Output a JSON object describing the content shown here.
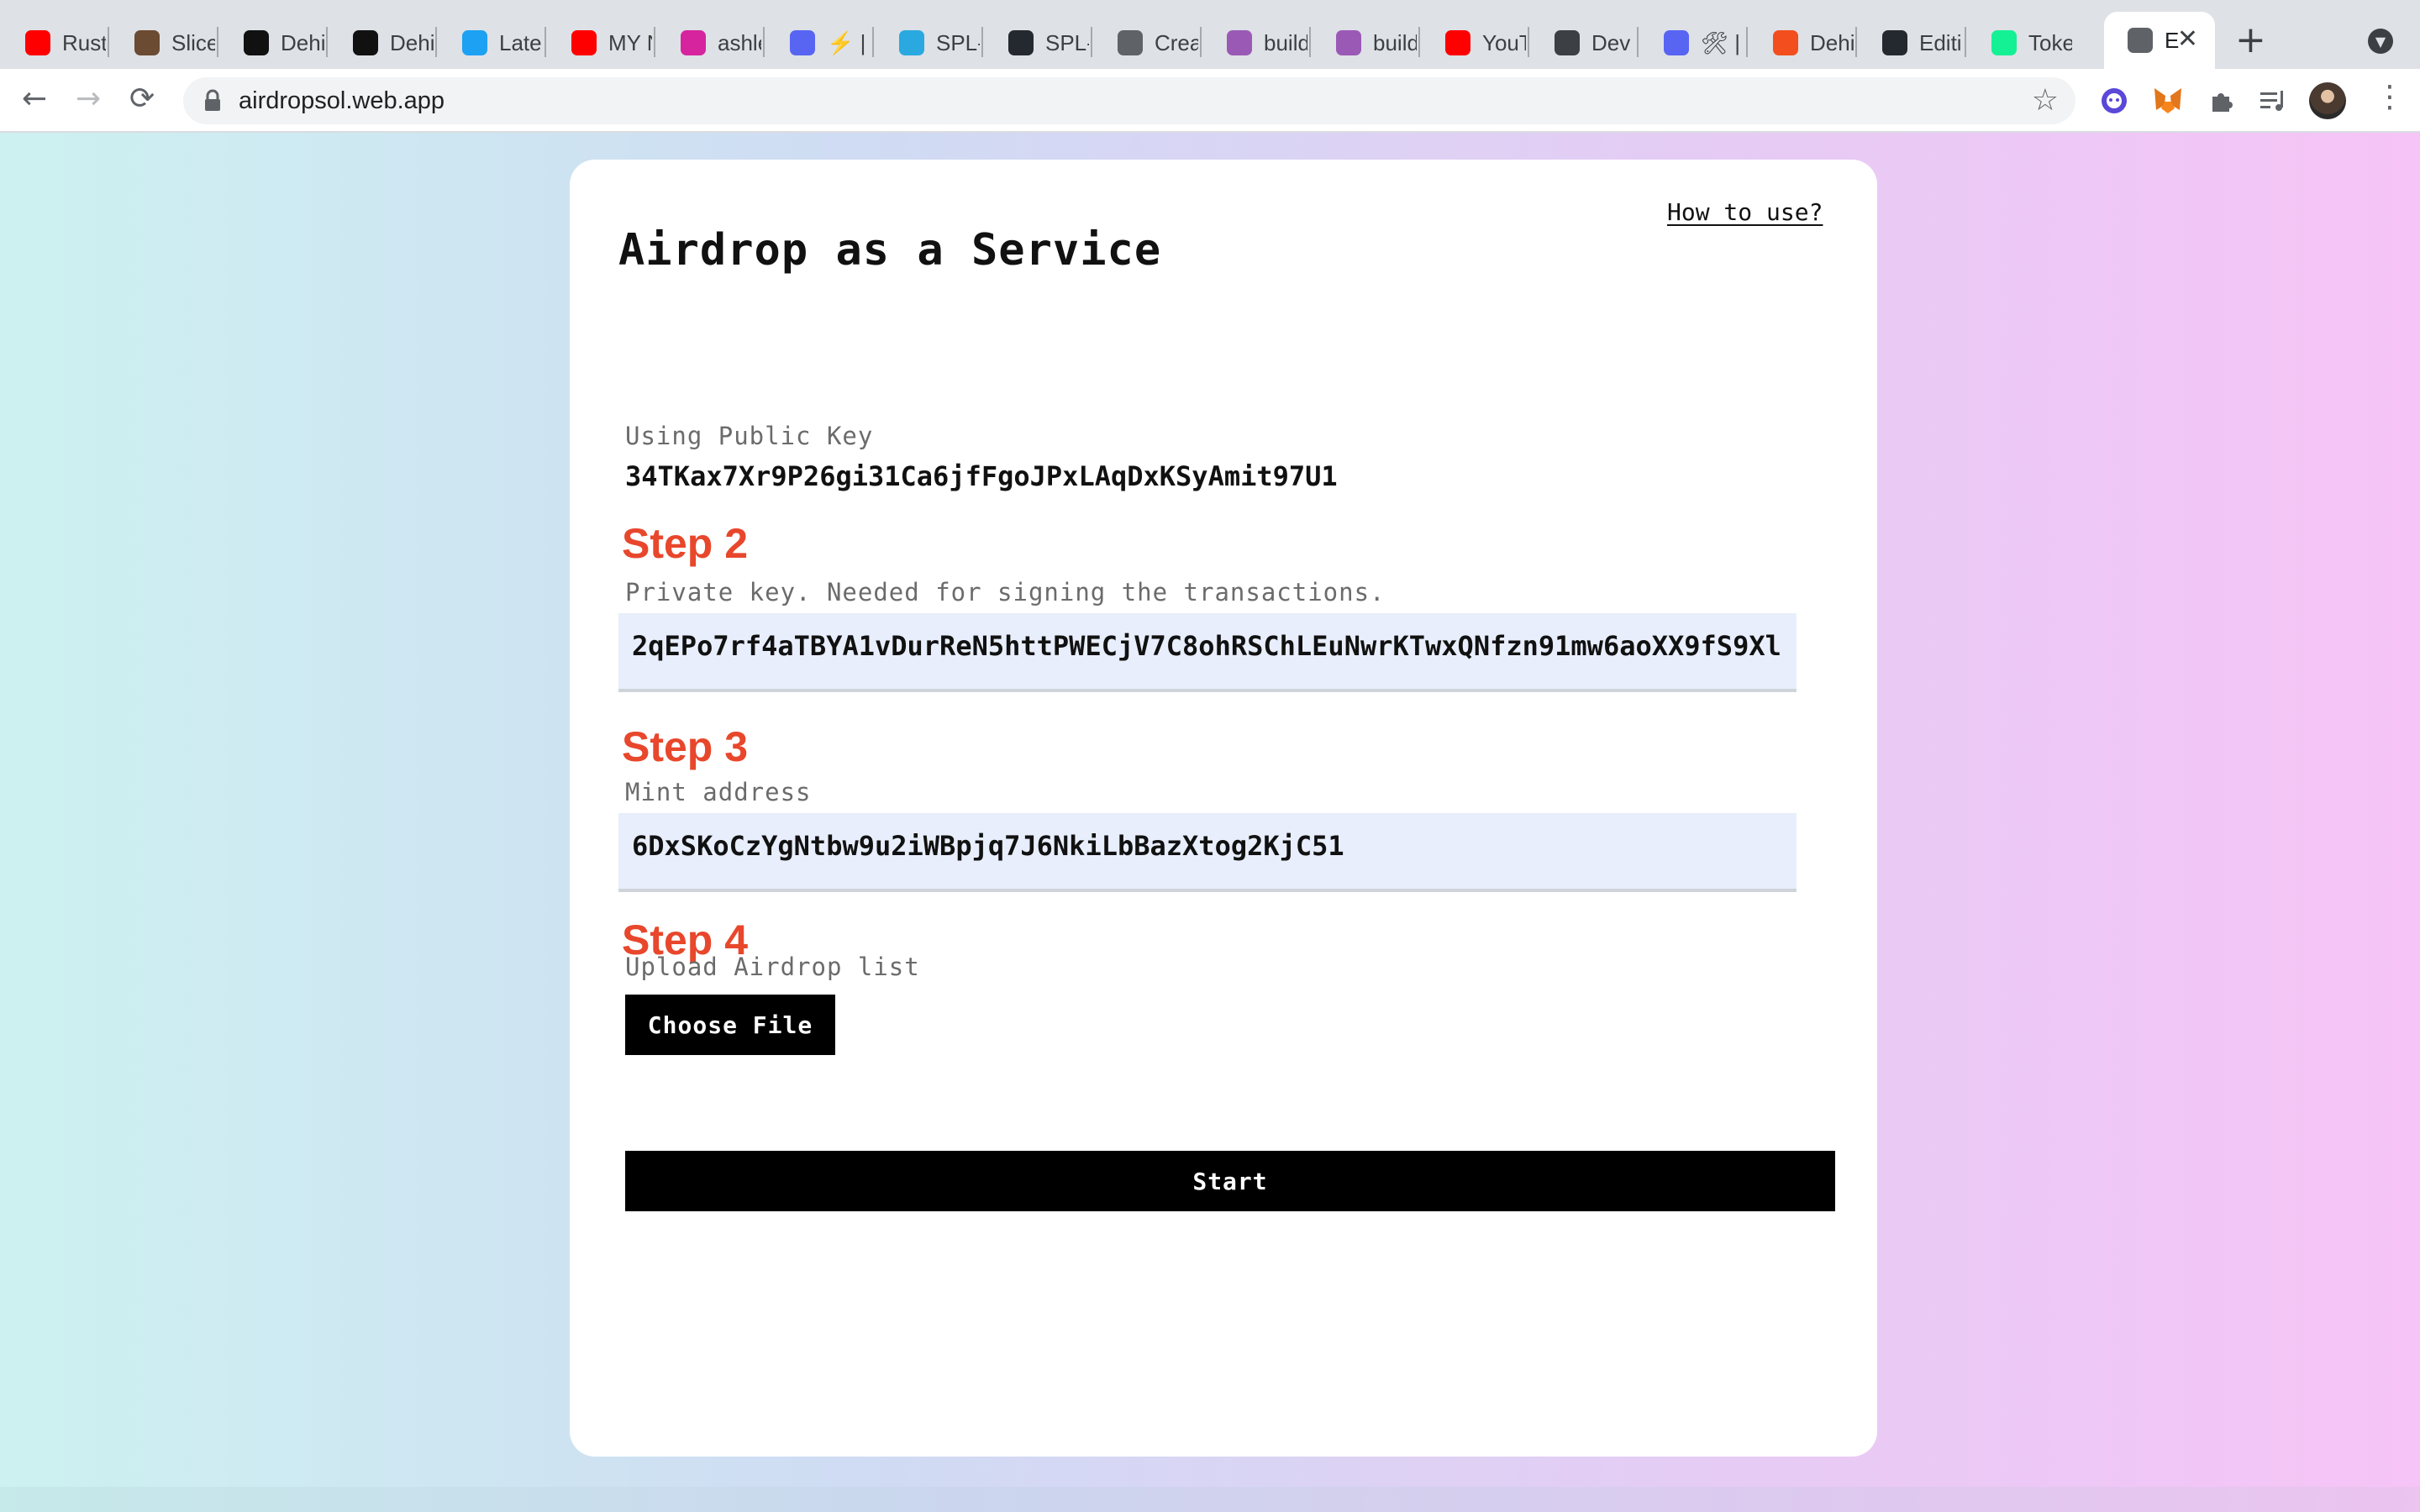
{
  "browser": {
    "tabs": [
      {
        "label": "Rust",
        "icon": "youtube-icon",
        "color": "#ff0000"
      },
      {
        "label": "Slice",
        "icon": "avatar-icon",
        "color": "#6b4b32"
      },
      {
        "label": "Dehi",
        "icon": "dehi-icon",
        "color": "#111111"
      },
      {
        "label": "Dehi",
        "icon": "dehi-icon",
        "color": "#111111"
      },
      {
        "label": "Late",
        "icon": "twitter-icon",
        "color": "#1da1f2"
      },
      {
        "label": "MY N",
        "icon": "youtube-icon",
        "color": "#ff0000"
      },
      {
        "label": "ashle",
        "icon": "instagram-icon",
        "color": "#d6249f"
      },
      {
        "label": "⚡️ |",
        "icon": "discord-icon",
        "color": "#5865f2"
      },
      {
        "label": "SPL-",
        "icon": "droplet-icon",
        "color": "#2aa9e0"
      },
      {
        "label": "SPL-",
        "icon": "github-icon",
        "color": "#24292f"
      },
      {
        "label": "Crea",
        "icon": "gear-icon",
        "color": "#5f6368"
      },
      {
        "label": "build",
        "icon": "unicorn-icon",
        "color": "#9b59b6"
      },
      {
        "label": "build",
        "icon": "unicorn-icon",
        "color": "#9b59b6"
      },
      {
        "label": "YouT",
        "icon": "youtube-icon",
        "color": "#ff0000"
      },
      {
        "label": "Dev",
        "icon": "floppy-icon",
        "color": "#3c4043"
      },
      {
        "label": "🛠 |",
        "icon": "discord-icon",
        "color": "#5865f2"
      },
      {
        "label": "Dehi",
        "icon": "figma-icon",
        "color": "#f24e1e"
      },
      {
        "label": "Editi",
        "icon": "github-icon",
        "color": "#24292f"
      },
      {
        "label": "Toke",
        "icon": "solana-icon",
        "color": "#14f195"
      },
      {
        "label": "E",
        "icon": "globe-icon",
        "color": "#5f6368"
      }
    ],
    "url": "airdropsol.web.app"
  },
  "page": {
    "title": "Airdrop as a Service",
    "how_to_link": "How to use?",
    "public_key_label": "Using Public Key",
    "public_key_value": "34TKax7Xr9P26gi31Ca6jfFgoJPxLAqDxKSyAmit97U1",
    "step2_heading": "Step 2",
    "step2_label": "Private key. Needed for signing the transactions.",
    "private_key_value": "2qEPo7rf4aTBYA1vDurReN5httPWECjV7C8ohRSChLEuNwrKTwxQNfzn91mw6aoXX9fS9Xl",
    "step3_heading": "Step 3",
    "step3_label": "Mint address",
    "mint_address_value": "6DxSKoCzYgNtbw9u2iWBpjq7J6NkiLbBazXtog2KjC51",
    "step4_heading": "Step 4",
    "step4_label": "Upload Airdrop list",
    "choose_file_label": "Choose File",
    "start_label": "Start"
  },
  "colors": {
    "step_heading": "#e8472c",
    "field_bg": "#e8eefb",
    "button_bg": "#000000"
  }
}
